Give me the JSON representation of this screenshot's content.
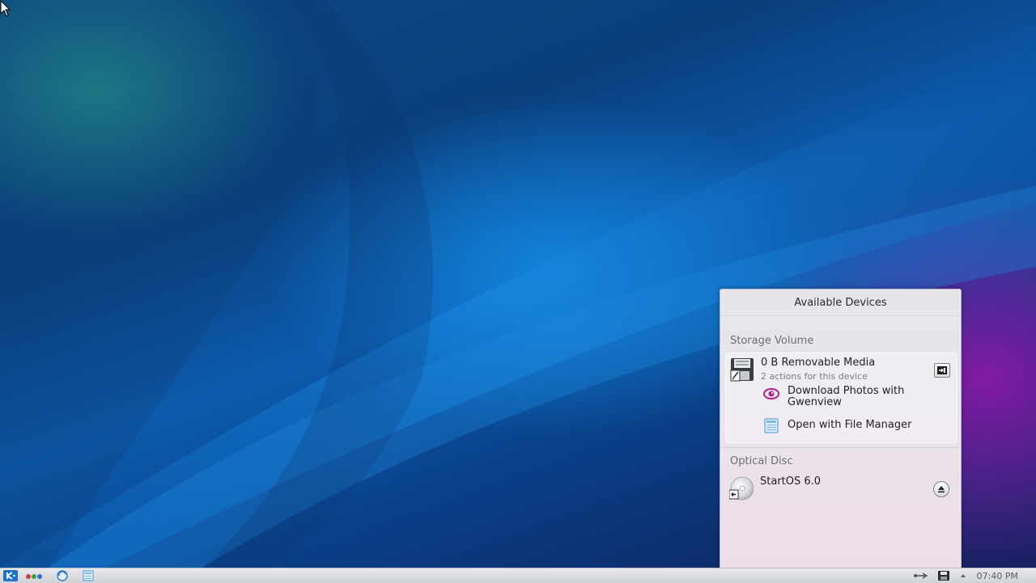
{
  "popup": {
    "title": "Available Devices",
    "sections": [
      {
        "title": "Storage Volume",
        "device": {
          "name": "0 B Removable Media",
          "subtitle": "2 actions for this device",
          "icon": "floppy-disk-icon",
          "actions": [
            {
              "label": "Download Photos with Gwenview",
              "icon": "gwenview-eye-icon"
            },
            {
              "label": "Open with File Manager",
              "icon": "file-manager-icon"
            }
          ],
          "button_icon": "unmount-icon"
        }
      },
      {
        "title": "Optical Disc",
        "device": {
          "name": "StartOS 6.0",
          "icon": "optical-disc-icon",
          "button_icon": "eject-icon"
        }
      }
    ]
  },
  "taskbar": {
    "launcher_icon": "kde-launcher-icon",
    "items": [
      "activities-icon",
      "browser-icon",
      "file-manager-icon"
    ],
    "tray": [
      "usb-icon",
      "device-notifier-icon",
      "expand-tray-icon"
    ],
    "clock": "07:40 PM"
  },
  "colors": {
    "accent": "#1e73c8",
    "gwenview": "#b0208a"
  }
}
